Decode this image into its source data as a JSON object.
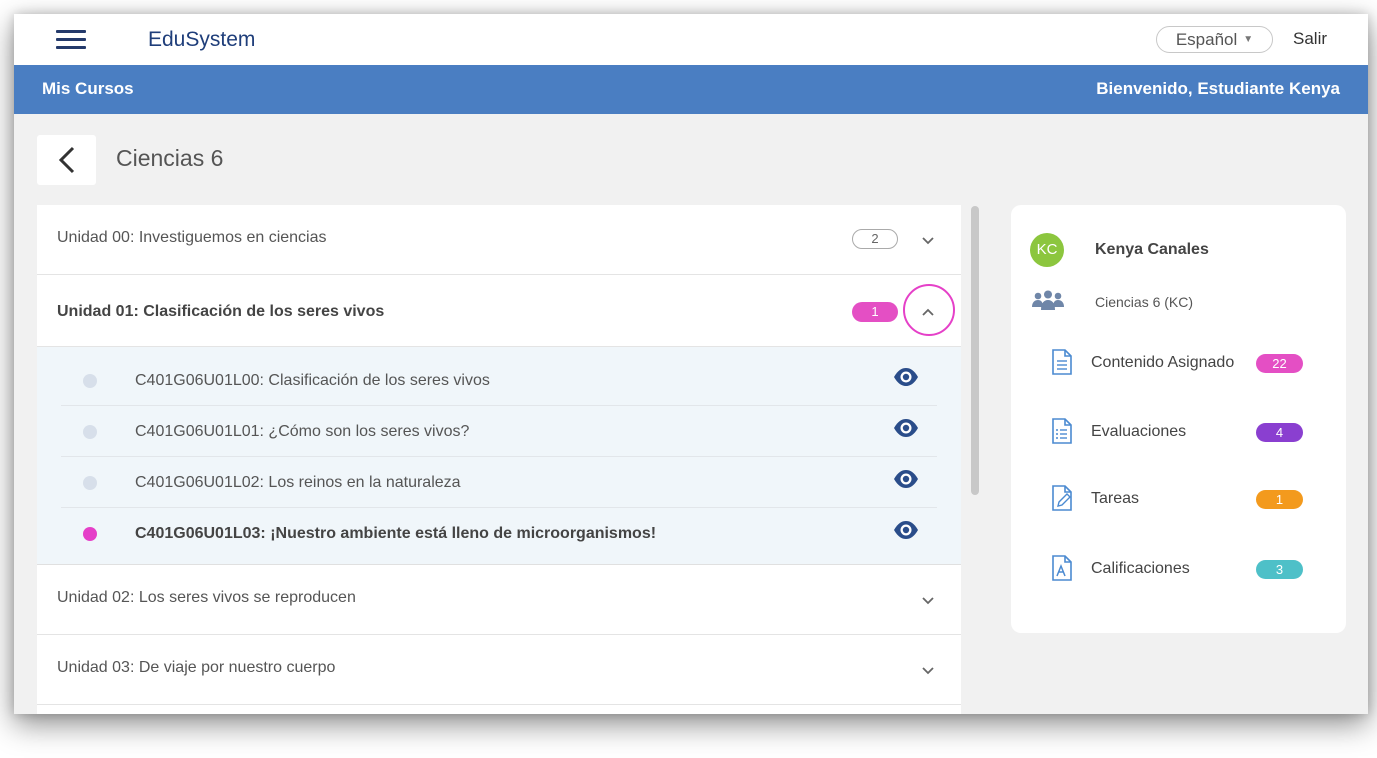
{
  "header": {
    "brand": "EduSystem",
    "language": "Español",
    "logout": "Salir"
  },
  "subheader": {
    "left": "Mis Cursos",
    "right": "Bienvenido, Estudiante Kenya"
  },
  "page": {
    "title": "Ciencias 6"
  },
  "units": [
    {
      "title": "Unidad 00: Investiguemos en ciencias",
      "count": "2",
      "expanded": false
    },
    {
      "title": "Unidad 01: Clasificación de los seres vivos",
      "count": "1",
      "expanded": true,
      "lessons": [
        {
          "text": "C401G06U01L00: Clasificación de los seres vivos",
          "active": false
        },
        {
          "text": "C401G06U01L01: ¿Cómo son los seres vivos?",
          "active": false
        },
        {
          "text": "C401G06U01L02: Los reinos en la naturaleza",
          "active": false
        },
        {
          "text": "C401G06U01L03: ¡Nuestro ambiente está lleno de microorganismos!",
          "active": true
        }
      ]
    },
    {
      "title": "Unidad 02: Los seres vivos se reproducen",
      "expanded": false
    },
    {
      "title": "Unidad 03: De viaje por nuestro cuerpo",
      "expanded": false
    }
  ],
  "profile": {
    "initials": "KC",
    "name": "Kenya Canales",
    "group": "Ciencias 6 (KC)",
    "menu": [
      {
        "label": "Contenido Asignado",
        "count": "22",
        "color": "#e44fc4",
        "icon": "document-icon"
      },
      {
        "label": "Evaluaciones",
        "count": "4",
        "color": "#8a3fd0",
        "icon": "list-document-icon"
      },
      {
        "label": "Tareas",
        "count": "1",
        "color": "#f39a1d",
        "icon": "edit-document-icon"
      },
      {
        "label": "Calificaciones",
        "count": "3",
        "color": "#4ec0c8",
        "icon": "grade-document-icon"
      }
    ]
  },
  "colors": {
    "accent": "#4a7ec2",
    "highlight": "#e540c8",
    "brand": "#1f3e7a"
  }
}
